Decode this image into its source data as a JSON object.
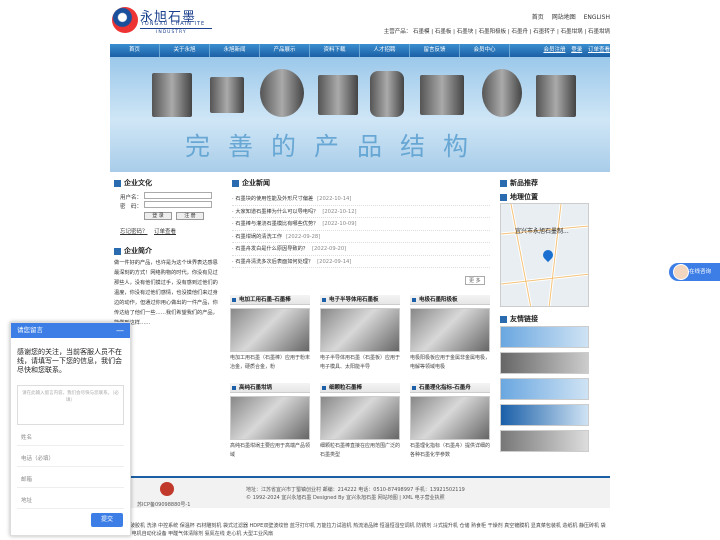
{
  "header": {
    "logo_cn": "永旭石墨",
    "logo_en": "YONGXU CHAIN ITE",
    "logo_sub": "INDUSTRY",
    "top_links": [
      "首页",
      "网站地图",
      "ENGLISH"
    ],
    "main_products": "主营产品：  石墨模 | 石墨板 | 石墨块 | 石墨阳极板 | 石墨舟 | 石墨转子 | 石墨坩埚 | 石墨坩埚"
  },
  "nav": {
    "items": [
      "首页",
      "关于永旭",
      "永旭新闻",
      "产品展示",
      "资料下载",
      "人才招聘",
      "留言反馈",
      "会员中心"
    ],
    "login": [
      "会员注册",
      "登录",
      "订单查看"
    ]
  },
  "banner": {
    "slogan": "完善的产品结构"
  },
  "corp": {
    "title": "企业文化",
    "user_label": "用户名：",
    "pass_label": "密　码：",
    "login_btn": "登 录",
    "register_btn": "注 册",
    "forgot": "忘记密码？",
    "order": "订单查看"
  },
  "intro": {
    "title": "企业简介",
    "text": "做一件好的产品，也许是为这个世界表达感恩最深刻的方式！网络购物的时代，你没有见过那些人，没有他们摸过手，没有感到过他们的温度，你没有过他们感情，也没摸他们来过身边的动作，但通过你用心做出的一件产品，你传达给了他们一些……我们希望我们的产品，能做到这样……"
  },
  "news": {
    "title": "企业新闻",
    "items": [
      {
        "t": "石墨块的使用性能及外形尺寸偏差",
        "d": "[2022-10-14]"
      },
      {
        "t": "大家知道石墨棒为什么可以导电吗？",
        "d": "[2022-10-12]"
      },
      {
        "t": "石墨棒与灌浇石墨模比有哪些优势？",
        "d": "[2022-10-09]"
      },
      {
        "t": "石墨坩埚的清洗工作",
        "d": "[2022-09-28]"
      },
      {
        "t": "石墨舟发白是什么原因导致的？",
        "d": "[2022-09-20]"
      },
      {
        "t": "石墨舟清洗多次后表面如何处理？",
        "d": "[2022-09-14]"
      }
    ],
    "more": "更 多"
  },
  "products": [
    {
      "title": "电加工用石墨-石墨棒",
      "desc": "电加工用石墨（石墨棒）应用于粉末冶金，硬质合金，粉"
    },
    {
      "title": "电子半导体用石墨板",
      "desc": "电子半导体用石墨（石墨板）应用于电子模具、太阳能半导"
    },
    {
      "title": "电极石墨阳极板",
      "desc": "电极阳极板应用于金属非金属电极，电解等领域电极"
    },
    {
      "title": "高纯石墨坩埚",
      "desc": "高纯石墨坩埚主要应用于高端产品领域"
    },
    {
      "title": "细颗粒石墨棒",
      "desc": "细颗粒石墨棒直接在应用范围广泛的石墨类型"
    },
    {
      "title": "石墨理化指标-石墨舟",
      "desc": "石墨理化指标（石墨舟）提供详细的各种石墨化学参数"
    }
  ],
  "side": {
    "rec_title": "新品推荐",
    "loc_title": "地理位置",
    "map_label": "宜兴市永旭石墨制...",
    "links_title": "友情链接"
  },
  "footer": {
    "icp": "苏ICP备09098880号-1",
    "address": "地址：江苏省宜兴市丁蜀镇创业村  邮编：214222  电话：0510-87498997  手机：13921502119",
    "copyright": "© 1992-2024 宜兴永旭石墨  Designed By 宜兴永旭石墨  网站地图 | XML 电子营业执照"
  },
  "keywords": "关键词：破胶机 洗涤 中控系统 保温杯 石材雕刻机 袋式过滤器 HDPE双壁波纹管 蓝牙打印机 万能拉力试验机 热流道品牌 恒温恒湿空调机 防锈剂 斗式提升机 仓储 熟食柜 干燥剂 真空镀膜机 显真菜包装机 造纸机 静压砖机 袋式过滤器 电机自动化设备 甲醛气体清除剂 氨氮在线 走心机 大型工业风扇",
  "chat": {
    "title": "请您留言",
    "min": "—",
    "message": "感谢您的关注，当前客服人员不在线，请填写一下您的信息，我们会尽快和您联系。",
    "placeholder": "请在此输入留言内容，我们会尽快与您联系。（必填）",
    "fields": [
      "姓名",
      "电话（必填）",
      "邮箱",
      "地址"
    ],
    "submit": "提交"
  },
  "online": {
    "label": "在线咨询"
  }
}
